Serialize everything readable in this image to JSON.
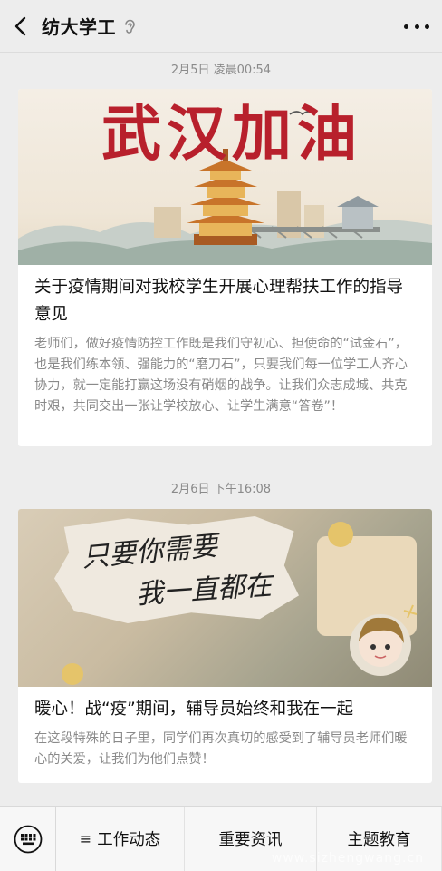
{
  "header": {
    "title": "纺大学工",
    "back_icon": "chevron-left-icon",
    "more_icon": "more-dots-icon"
  },
  "messages": [
    {
      "time": "2月5日 凌晨00:54",
      "cover_text": "武汉加油",
      "title": "关于疫情期间对我校学生开展心理帮扶工作的指导意见",
      "digest": "老师们，做好疫情防控工作既是我们守初心、担使命的“试金石”，也是我们练本领、强能力的“磨刀石”，只要我们每一位学工人齐心协力，就一定能打赢这场没有硝烟的战争。让我们众志成城、共克时艰，共同交出一张让学校放心、让学生满意“答卷”！"
    },
    {
      "time": "2月6日 下午16:08",
      "cover_text_line1": "只要你需要",
      "cover_text_line2": "我一直都在",
      "title": "暖心！战“疫”期间，辅导员始终和我在一起",
      "digest": "在这段特殊的日子里，同学们再次真切的感受到了辅导员老师们暖心的关爱，让我们为他们点赞！"
    }
  ],
  "menu": {
    "keyboard_icon": "keyboard-icon",
    "items": [
      {
        "label": "工作动态",
        "icon": "list-icon",
        "icon_glyph": "≡"
      },
      {
        "label": "重要资讯"
      },
      {
        "label": "主题教育"
      }
    ]
  },
  "watermark": "www.sizhengwang.cn",
  "colors": {
    "background": "#ededed",
    "card": "#ffffff",
    "banner_red": "#b8202c",
    "digest_gray": "#8a8a8a"
  }
}
